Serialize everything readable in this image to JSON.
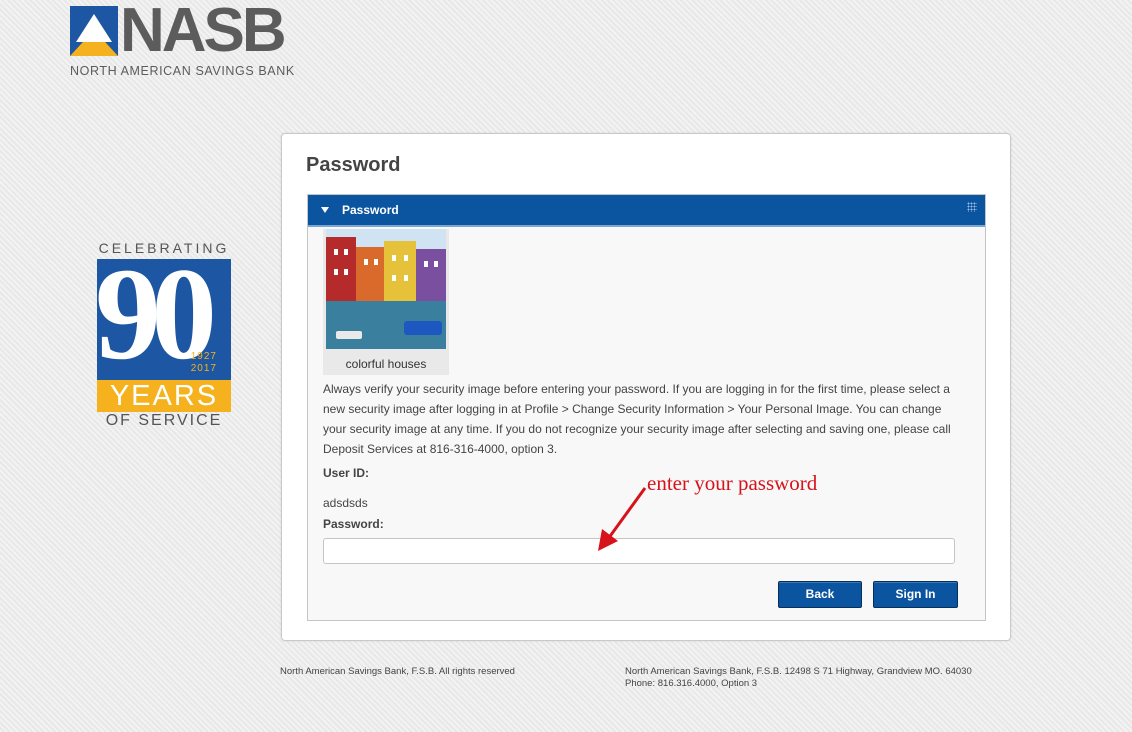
{
  "brand": {
    "name": "NASB",
    "subtitle": "NORTH AMERICAN SAVINGS BANK",
    "colors": {
      "blue": "#1d57a3",
      "gold": "#f5b21e",
      "gray": "#5c5c5c"
    }
  },
  "badge": {
    "top_text": "CELEBRATING",
    "number": "90",
    "year_start": "1927",
    "year_end": "2017",
    "years_word": "YEARS",
    "bottom_text": "OF SERVICE"
  },
  "page": {
    "title": "Password"
  },
  "section": {
    "header": "Password",
    "security_image_caption": "colorful houses",
    "info_text": "Always verify your security image before entering your password. If you are logging in for the first time, please select a new security image after logging in at Profile > Change Security Information > Your Personal Image. You can change your security image at any time. If you do not recognize your security image after selecting and saving one, please call Deposit Services at 816-316-4000, option 3.",
    "user_id_label": "User ID:",
    "user_id_value": "adsdsds",
    "password_label": "Password:",
    "password_value": "",
    "back_label": "Back",
    "sign_in_label": "Sign In"
  },
  "annotation": {
    "text": "enter your password",
    "color": "#d6121b"
  },
  "footer": {
    "left": "North American Savings Bank, F.S.B. All rights reserved",
    "right_line1": "North American Savings Bank, F.S.B. 12498 S 71 Highway, Grandview MO. 64030",
    "right_line2": "Phone: 816.316.4000, Option 3"
  }
}
